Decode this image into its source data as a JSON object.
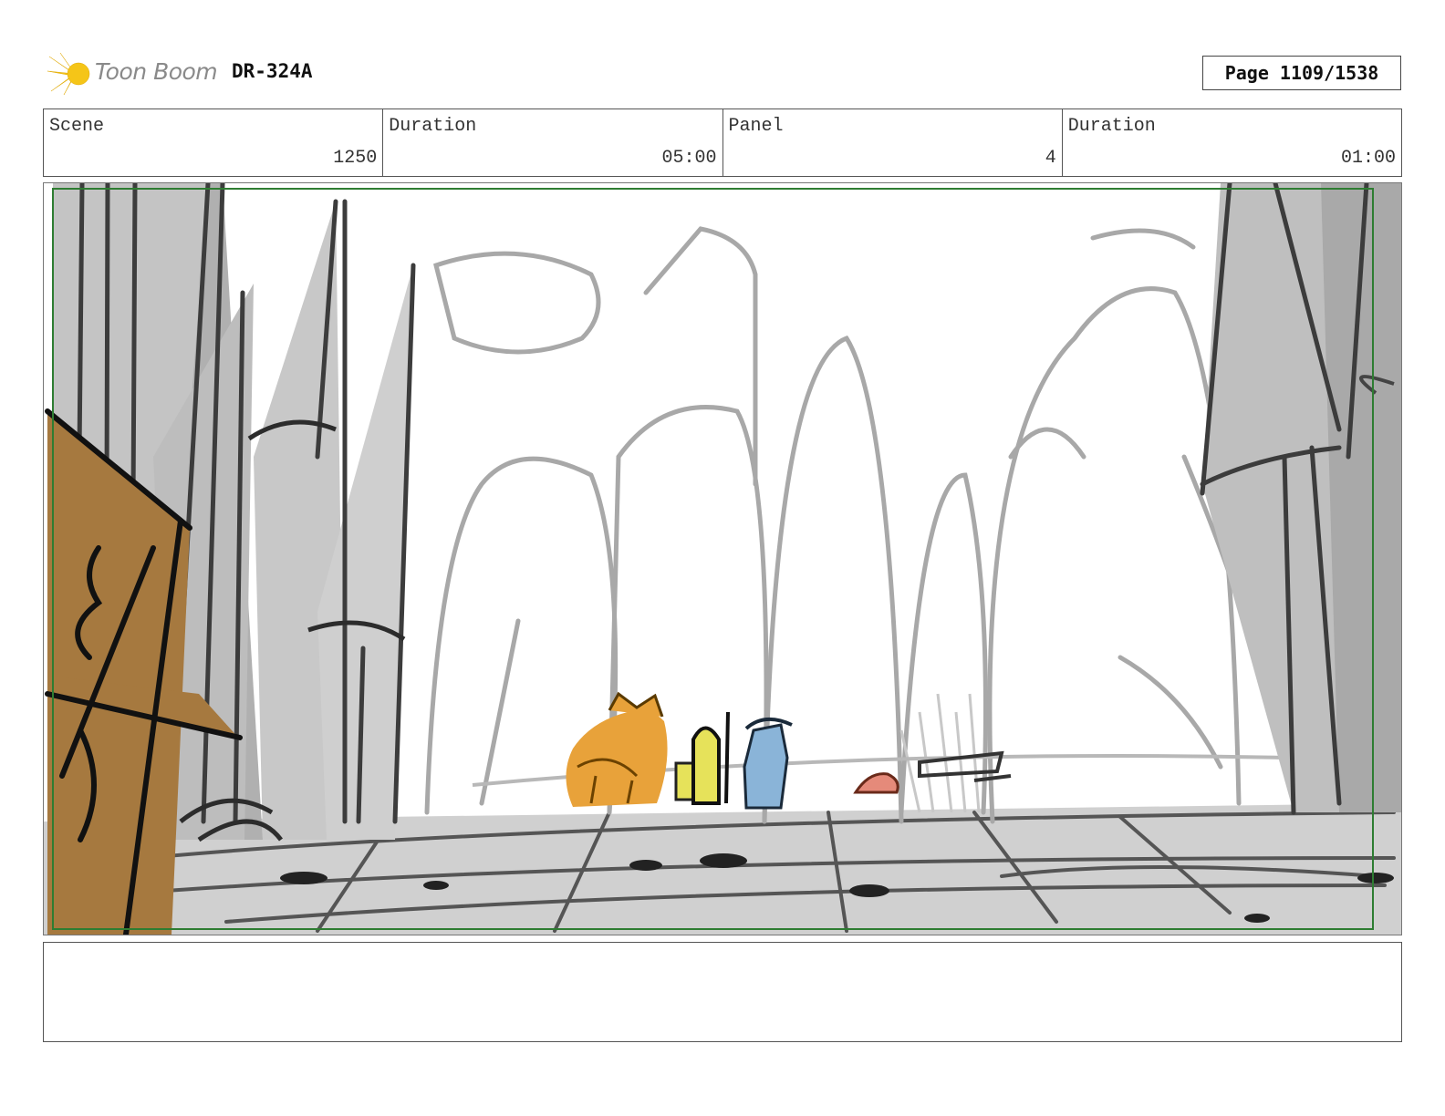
{
  "header": {
    "logo_text": "Toon Boom",
    "project_code": "DR-324A",
    "page_label": "Page 1109/1538"
  },
  "info_fields": [
    {
      "label": "Scene",
      "value": "1250"
    },
    {
      "label": "Duration",
      "value": "05:00"
    },
    {
      "label": "Panel",
      "value": "4"
    },
    {
      "label": "Duration",
      "value": "01:00"
    }
  ],
  "colors": {
    "logo_burst": "#f5c518",
    "safe_frame": "#2e7d32",
    "wood": "#a6793f",
    "char_orange": "#e8a23a",
    "char_yellow": "#e6e25a",
    "char_blue": "#8ab4d8",
    "char_pink": "#e58a7a"
  },
  "notes": {
    "text": ""
  }
}
